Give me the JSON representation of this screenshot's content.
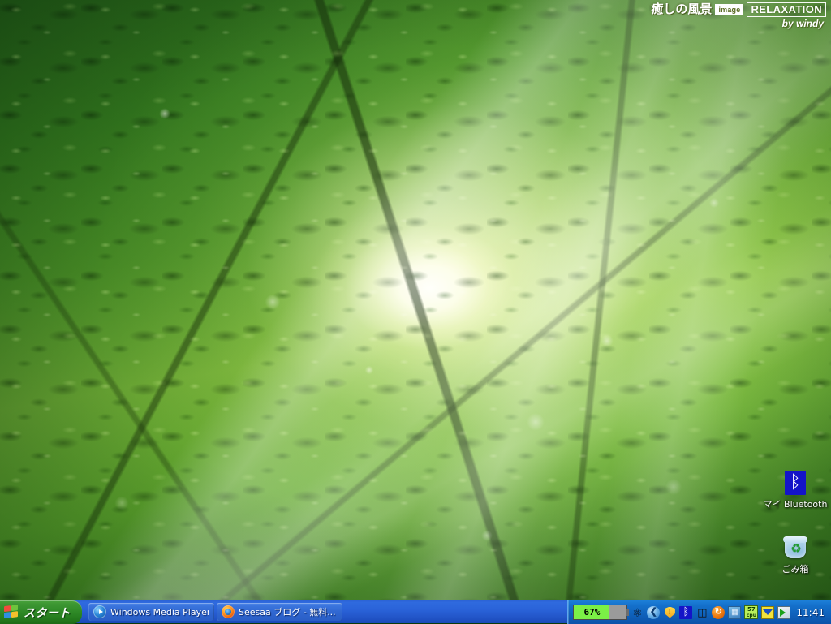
{
  "desktop": {
    "wallpaper": {
      "description": "sunlit green forest canopy with sun rays",
      "dominant_color": "#5ca32c",
      "highlight_color": "#ffffef",
      "shadow_color": "#1e5412"
    },
    "watermark": {
      "title_jp": "癒しの風景",
      "badge": "image",
      "brand": "RELAXATION",
      "author": "by windy"
    },
    "icons": [
      {
        "id": "bluetooth",
        "label": "マイ Bluetooth",
        "glyph": "ᛒ",
        "icon_name": "bluetooth-icon",
        "color": "#1414c8"
      },
      {
        "id": "recyclebin",
        "label": "ごみ箱",
        "glyph": "♻",
        "icon_name": "recycle-bin-icon",
        "color": "#1f9d2f"
      }
    ]
  },
  "taskbar": {
    "start": {
      "label": "スタート",
      "icon_name": "windows-flag-icon",
      "color": "#2f8a27"
    },
    "buttons": [
      {
        "label": "Windows Media Player",
        "icon_name": "windows-media-player-icon",
        "active": false
      },
      {
        "label": "Seesaa ブログ - 無料...",
        "icon_name": "firefox-icon",
        "active": false
      }
    ],
    "tray": {
      "battery": {
        "value": "67%",
        "percent": 67,
        "icon_name": "battery-meter-icon",
        "fill_color": "#7bf046"
      },
      "icons": [
        {
          "id": "power-plug",
          "icon_name": "power-plug-icon",
          "glyph": "⚡"
        },
        {
          "id": "show-hidden",
          "icon_name": "chevron-left-icon",
          "glyph": "❮"
        },
        {
          "id": "security-center",
          "icon_name": "shield-warning-icon",
          "glyph": "!"
        },
        {
          "id": "bluetooth-tray",
          "icon_name": "bluetooth-icon",
          "glyph": "ᛒ"
        },
        {
          "id": "safely-remove",
          "icon_name": "eject-device-icon",
          "glyph": "⬒"
        },
        {
          "id": "updater",
          "icon_name": "refresh-circle-icon",
          "glyph": "↻"
        },
        {
          "id": "network",
          "icon_name": "network-icon",
          "glyph": "▦"
        },
        {
          "id": "volume",
          "icon_name": "volume-icon",
          "glyph": "◀"
        },
        {
          "id": "explorer-tool",
          "icon_name": "folder-play-icon",
          "glyph": "▶"
        }
      ],
      "cpu_meter": {
        "value": "57",
        "label": "cpu",
        "icon_name": "cpu-meter-icon",
        "color": "#b9f05a"
      },
      "clock": "11:41"
    }
  }
}
